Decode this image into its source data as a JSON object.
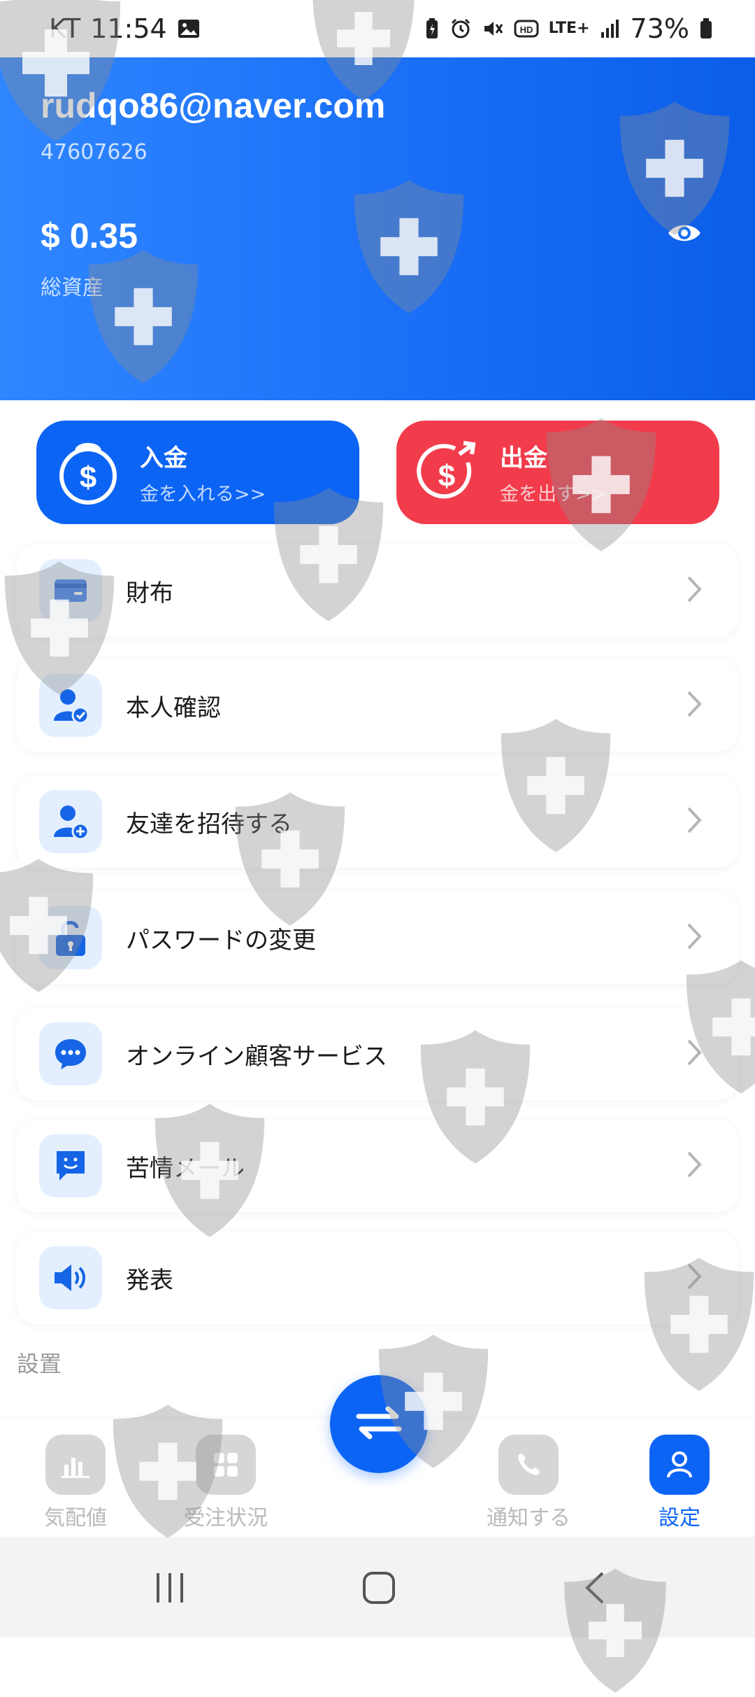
{
  "status_bar": {
    "carrier": "KT",
    "time": "11:54",
    "network": "LTE+",
    "battery": "73%"
  },
  "account": {
    "email": "rudqo86@naver.com",
    "user_id": "47607626",
    "balance": "$ 0.35",
    "balance_label": "総資産"
  },
  "actions": {
    "deposit_title": "入金",
    "deposit_sub": "金を入れる>>",
    "withdraw_title": "出金",
    "withdraw_sub": "金を出す>>"
  },
  "menu": [
    {
      "label": "財布",
      "icon": "wallet-icon"
    },
    {
      "label": "本人確認",
      "icon": "user-verified-icon"
    },
    {
      "label": "友達を招待する",
      "icon": "user-add-icon"
    },
    {
      "label": "パスワードの変更",
      "icon": "lock-open-icon"
    },
    {
      "label": "オンライン顧客サービス",
      "icon": "chat-bubble-icon"
    },
    {
      "label": "苦情メール",
      "icon": "feedback-message-icon"
    },
    {
      "label": "発表",
      "icon": "speaker-icon"
    }
  ],
  "section": {
    "settings_title": "設置"
  },
  "bottom_nav": [
    {
      "label": "気配値",
      "icon": "bar-chart-icon",
      "active": false
    },
    {
      "label": "受注状況",
      "icon": "grid-icon",
      "active": false
    },
    {
      "label": "通知する",
      "icon": "phone-icon",
      "active": false
    },
    {
      "label": "設定",
      "icon": "user-icon",
      "active": true
    }
  ],
  "fab": {
    "icon": "swap-arrows-icon"
  },
  "colors": {
    "primary": "#0c64f5",
    "danger": "#f23c4b",
    "header_start": "#2f86ff",
    "header_end": "#0b5de8"
  }
}
